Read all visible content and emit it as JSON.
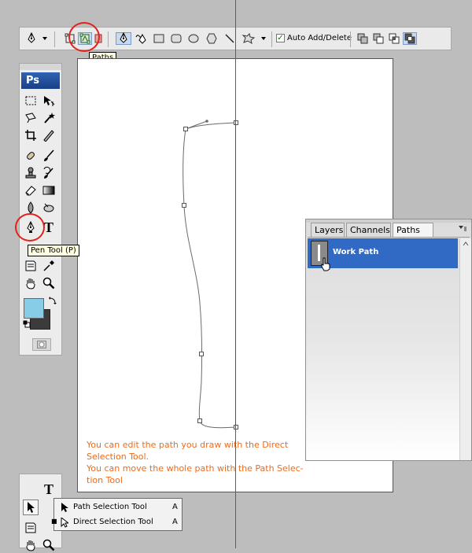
{
  "options_bar": {
    "auto_add_delete_label": "Auto Add/Delete",
    "auto_add_delete_checked": true,
    "paths_tooltip": "Paths"
  },
  "tools": {
    "logo": "Ps",
    "type_tool_glyph": "T",
    "pen_tool_tooltip": "Pen Tool (P)"
  },
  "canvas": {
    "instructions": "You can edit the path you draw with the Direct Selection Tool.\nYou can move the whole path with the Path Selec-\ntion Tool",
    "line1": "You can edit the path you draw with the Direct",
    "line2": "Selection Tool.",
    "line3": "You can move the whole path with the Path Selec-",
    "line4": "tion Tool"
  },
  "paths_panel": {
    "tabs": [
      {
        "label": "Layers"
      },
      {
        "label": "Channels"
      },
      {
        "label": "Paths",
        "close": "×"
      }
    ],
    "items": [
      {
        "label": "Work Path"
      }
    ]
  },
  "flyout": {
    "items": [
      {
        "label": "Path Selection Tool",
        "shortcut": "A",
        "active": false
      },
      {
        "label": "Direct Selection Tool",
        "shortcut": "A",
        "active": true
      }
    ],
    "active_marker": "■"
  },
  "colors": {
    "accent": "#316ac5",
    "annotation": "#e2201c",
    "instruction_text": "#f06a18",
    "foreground_swatch": "#87cde8",
    "background_swatch": "#3b3b3b"
  }
}
